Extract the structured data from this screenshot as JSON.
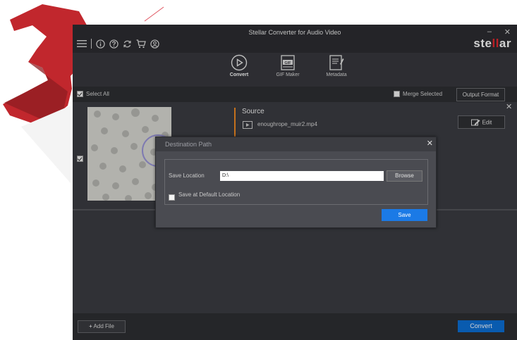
{
  "window": {
    "title": "Stellar Converter for Audio Video",
    "minimize": "–",
    "close": "✕",
    "brand": {
      "pre": "ste",
      "accent": "ll",
      "post": "ar"
    }
  },
  "toolbar": {
    "items": [
      {
        "label": "Convert",
        "icon": "play-circle-icon"
      },
      {
        "label": "GIF Maker",
        "icon": "gif-icon"
      },
      {
        "label": "Metadata",
        "icon": "metadata-icon"
      }
    ]
  },
  "selectbar": {
    "select_all": "Select All",
    "merge_selected": "Merge Selected",
    "output_format": "Output Format"
  },
  "file": {
    "source_heading": "Source",
    "filename": "enoughrope_muir2.mp4",
    "edit": "Edit",
    "remove": "✕"
  },
  "dialog": {
    "title": "Destination Path",
    "close": "✕",
    "save_location_label": "Save Location",
    "save_location_value": "D:\\",
    "browse": "Browse",
    "default_location": "Save at Default Location",
    "save": "Save"
  },
  "bottom": {
    "add_file": "Add File",
    "convert": "Convert"
  },
  "colors": {
    "accent_blue": "#0c6fd6",
    "brand_red": "#e3262f",
    "source_accent": "#f08a24"
  }
}
